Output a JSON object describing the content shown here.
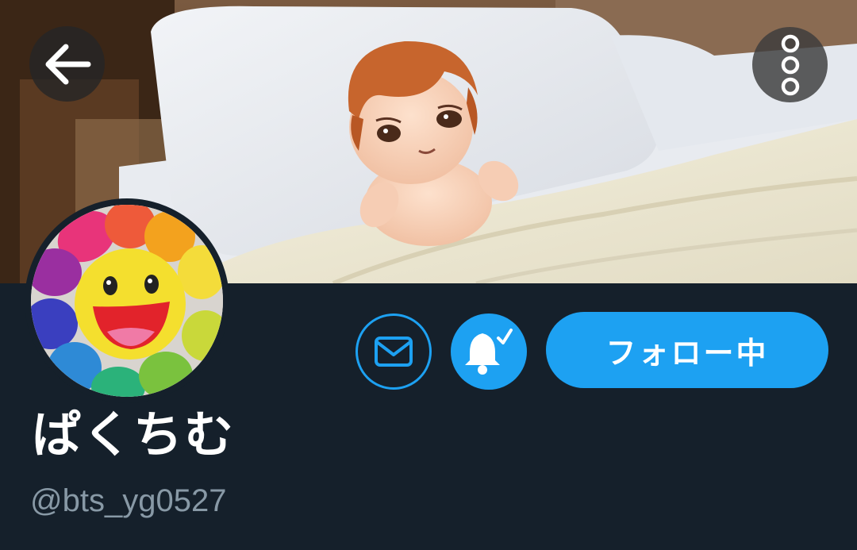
{
  "header": {
    "banner_photo": "plush-doll-on-bed-photo",
    "back_icon": "arrow-left-icon",
    "more_icon": "more-vertical-icon"
  },
  "profile": {
    "avatar_photo": "smiling-rainbow-flower-photo",
    "display_name": "ぱくちむ",
    "handle": "@bts_yg0527"
  },
  "actions": {
    "message_icon": "mail-icon",
    "notify_icon": "bell-check-icon",
    "follow_label": "フォロー中"
  },
  "colors": {
    "background": "#15202b",
    "accent": "#1da1f2",
    "handle_text": "#8899a6",
    "name_text": "#ffffff"
  }
}
